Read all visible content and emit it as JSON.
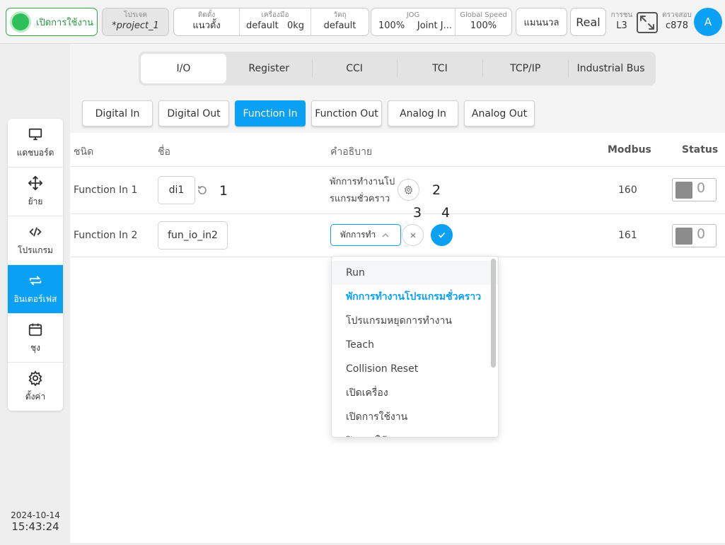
{
  "header": {
    "power_label": "เปิดการใช้งาน",
    "project": {
      "label": "โปรเจค",
      "value": "*project_1"
    },
    "install": {
      "label": "ติดตั้ง",
      "value": "แนวตั้ง"
    },
    "tool": {
      "label": "เครื่องมือ",
      "name": "default",
      "weight": "0kg"
    },
    "payload": {
      "label": "วัตถุ",
      "value": "default"
    },
    "jog": {
      "label": "JOG",
      "percent": "100%",
      "mode": "Joint J..."
    },
    "global_speed": {
      "label": "Global Speed",
      "value": "100%"
    },
    "manual_label": "แมนนวล",
    "real_label": "Real",
    "customer": {
      "label": "การชน",
      "value": "L3"
    },
    "check": {
      "label": "ตรวจสอบ",
      "value": "c878"
    },
    "avatar_letter": "A"
  },
  "sidebar": {
    "items": [
      {
        "label": "แดชบอร์ด",
        "icon": "monitor-icon"
      },
      {
        "label": "ย้าย",
        "icon": "move-icon"
      },
      {
        "label": "โปรแกรม",
        "icon": "code-icon"
      },
      {
        "label": "อินเตอร์เฟส",
        "icon": "interface-icon"
      },
      {
        "label": "ชุง",
        "icon": "calendar-icon"
      },
      {
        "label": "ตั้งค่า",
        "icon": "gear-icon"
      }
    ],
    "active_index": 3
  },
  "datetime": {
    "date": "2024-10-14",
    "time": "15:43:24"
  },
  "tabs": [
    "I/O",
    "Register",
    "CCI",
    "TCI",
    "TCP/IP",
    "Industrial Bus"
  ],
  "active_tab": "I/O",
  "subtabs": [
    "Digital In",
    "Digital Out",
    "Function In",
    "Function Out",
    "Analog In",
    "Analog Out"
  ],
  "active_subtab": "Function In",
  "table": {
    "headers": {
      "type": "ชนิด",
      "name": "ชื่อ",
      "description": "คำอธิบาย",
      "modbus": "Modbus",
      "status": "Status"
    },
    "rows": [
      {
        "type": "Function In 1",
        "name": "di1",
        "description_line1": "พักการทำงานโป",
        "description_line2": "รแกรมชั่วคราว",
        "modbus": "160",
        "status": "0"
      },
      {
        "type": "Function In 2",
        "name": "fun_io_in2",
        "select_value": "พักการทำ",
        "modbus": "161",
        "status": "0"
      }
    ]
  },
  "callouts": [
    "1",
    "2",
    "3",
    "4"
  ],
  "dropdown": {
    "options": [
      "Run",
      "พักการทำงานโปรแกรมชั่วคราว",
      "โปรแกรมหยุดการทำงาน",
      "Teach",
      "Collision Reset",
      "เปิดเครื่อง",
      "เปิดการใช้งาน",
      "ปิดการใช้งาน"
    ],
    "hover_index": 0,
    "selected_index": 1
  },
  "colors": {
    "accent": "#0aa1f5",
    "power": "#2fbf5a"
  }
}
